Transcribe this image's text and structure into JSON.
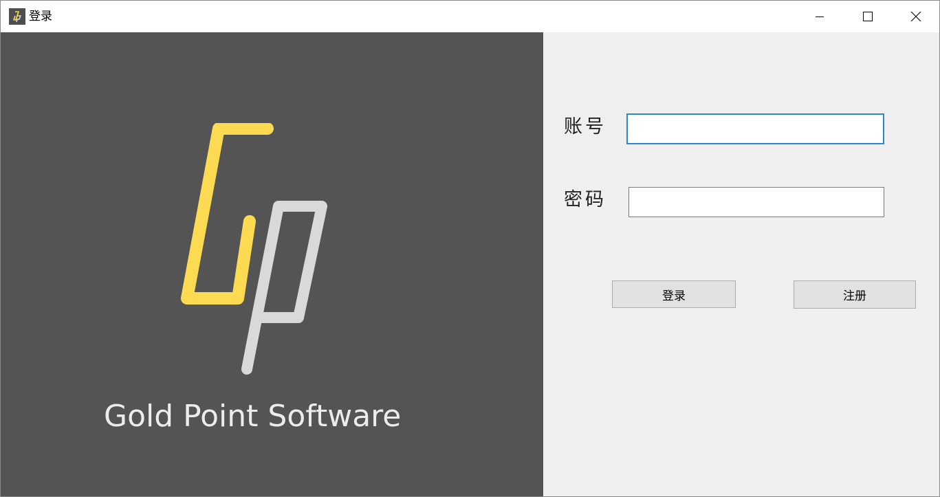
{
  "window": {
    "title": "登录",
    "controls": {
      "minimize_icon": "minimize-icon",
      "maximize_icon": "maximize-icon",
      "close_icon": "close-icon"
    }
  },
  "brand": {
    "name": "Gold Point Software",
    "logo_letters": "Gp",
    "colors": {
      "panel_bg": "#545454",
      "logo_g": "#FCDB52",
      "logo_p": "#D9D9D9",
      "text": "#ececec"
    }
  },
  "form": {
    "account_label": "账号",
    "account_value": "",
    "password_label": "密码",
    "password_value": "",
    "login_button": "登录",
    "register_button": "注册",
    "accent": "#2b86d6",
    "background": "#efefef"
  }
}
